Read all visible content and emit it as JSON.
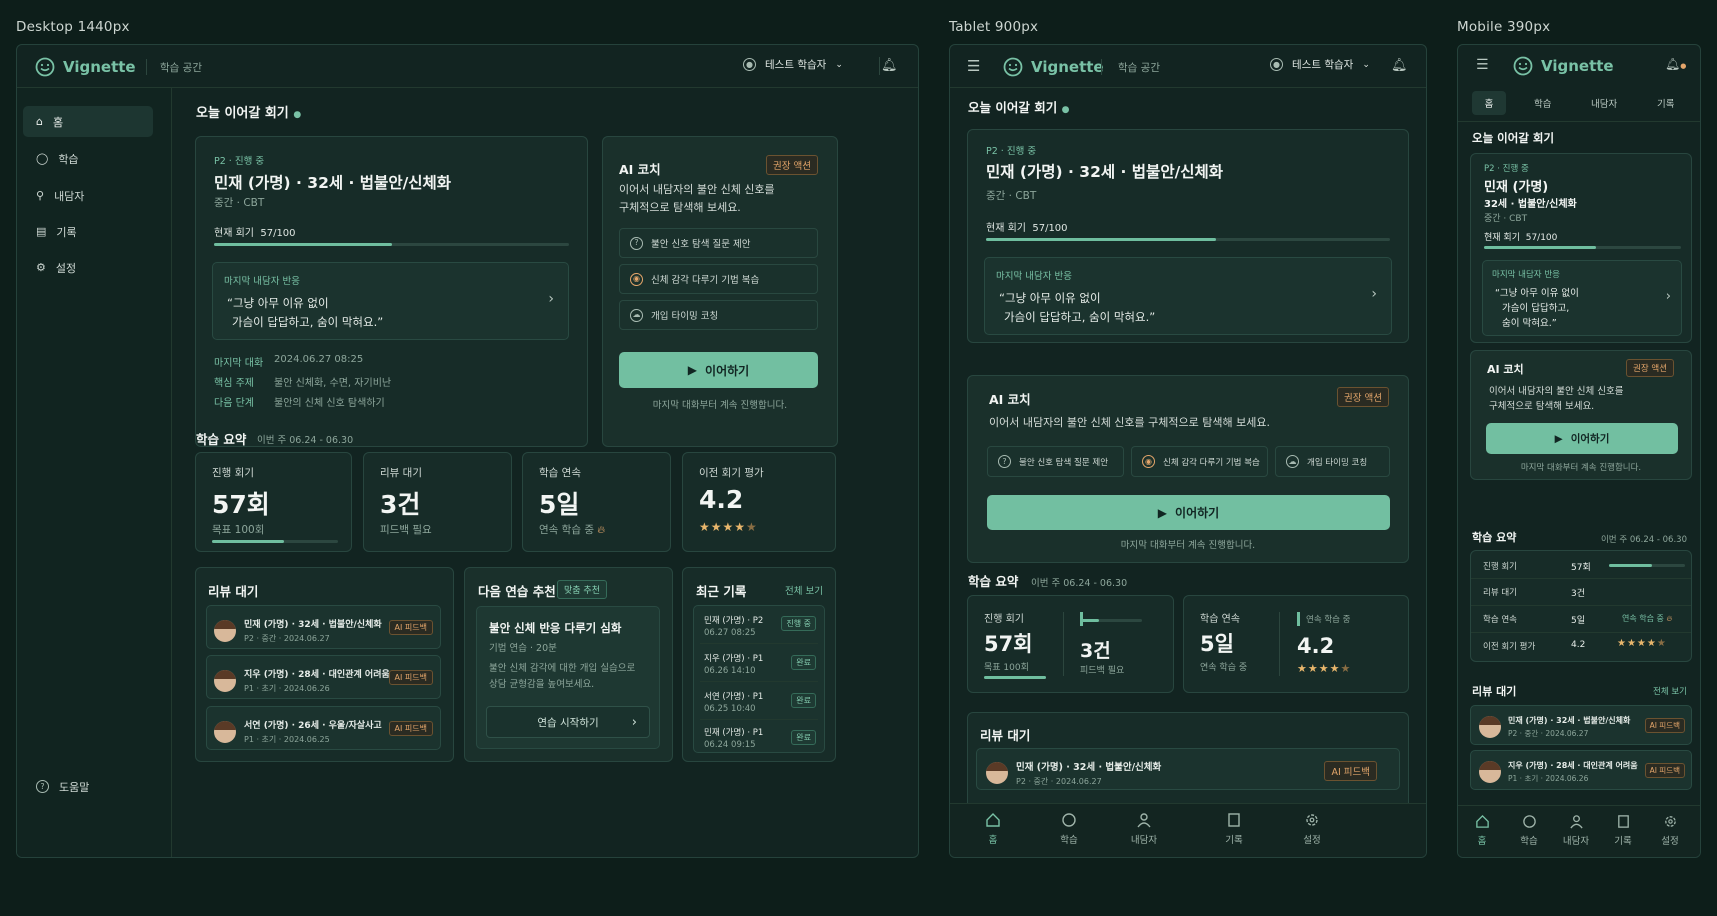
{
  "frames": {
    "desktop": "Desktop  1440px",
    "tablet": "Tablet  900px",
    "mobile": "Mobile  390px"
  },
  "app": {
    "name": "Vignette",
    "workspace": "학습 공간",
    "user": "테스트 학습자"
  },
  "nav": {
    "home": "홈",
    "learn": "학습",
    "clients": "내담자",
    "records": "기록",
    "settings": "설정",
    "help": "도움말"
  },
  "continue": {
    "title": "오늘 이어갈 회기",
    "tag": "P2 · 진행 중",
    "name": "민재 (가명) · 32세 · 법불안/신체화",
    "name_short": "민재 (가명)",
    "name_detail": "32세 · 법불안/신체화",
    "level": "중간 · CBT",
    "session_label": "현재 회기",
    "session_value": "57/100",
    "session_fraction": 0.57,
    "last_response_label": "마지막 내담자 반응",
    "quote1": "“그냥 아무 이유 없이",
    "quote2": "가슴이 답답하고, 숨이 막혀요.”",
    "quote2a": "가슴이 답답하고,",
    "quote2b": "숨이 막혀요.”",
    "last_chat_label": "마지막 대화",
    "last_chat": "2024.06.27  08:25",
    "topic_label": "핵심 주제",
    "topic": "불안 신체화, 수면, 자기비난",
    "next_label": "다음 단계",
    "next": "불안의 신체 신호 탐색하기"
  },
  "coach": {
    "title": "AI 코치",
    "badge": "권장 액션",
    "desc1": "이어서 내담자의 불안 신체 신호를",
    "desc2": "구체적으로 탐색해 보세요.",
    "desc_full": "이어서 내담자의 불안 신체 신호를 구체적으로 탐색해 보세요.",
    "chip1": "불안 신호 탐색 질문 제안",
    "chip2": "신체 감각 다루기 기법 복습",
    "chip3": "개입 타이밍 코칭",
    "cta": "이어하기",
    "note": "마지막 대화부터 계속 진행합니다."
  },
  "summary": {
    "title": "학습 요약",
    "range": "이번 주  06.24 - 06.30",
    "s1_label": "진행 회기",
    "s1_value": "57회",
    "s1_sub": "목표 100회",
    "s1_fraction": 0.57,
    "s2_label": "리뷰 대기",
    "s2_value": "3건",
    "s2_sub": "피드백 필요",
    "s3_label": "학습 연속",
    "s3_value": "5일",
    "s3_sub": "연속 학습 중",
    "s4_label": "이전 회기 평가",
    "s4_value": "4.2",
    "rating": 4.2
  },
  "review": {
    "title": "리뷰 대기",
    "all": "전체 보기",
    "items": [
      {
        "name": "민재 (가명) · 32세 · 법불안/신체화",
        "meta": "P2 · 중간 · 2024.06.27",
        "badge": "AI 피드백"
      },
      {
        "name": "지우 (가명) · 28세 · 대인관계 어려움",
        "meta": "P1 · 초기 · 2024.06.26",
        "badge": "AI 피드백"
      },
      {
        "name": "서연 (가명) · 26세 · 우울/자살사고",
        "meta": "P1 · 초기 · 2024.06.25",
        "badge": "AI 피드백"
      }
    ]
  },
  "practice": {
    "title": "다음 연습 추천",
    "badge": "맞춤 추천",
    "name": "불안 신체 반응 다루기 심화",
    "meta": "기법 연습 · 20분",
    "desc1": "불안 신체 감각에 대한 개입 실습으로",
    "desc2": "상담 균형감을 높여보세요.",
    "cta": "연습 시작하기"
  },
  "records": {
    "title": "최근 기록",
    "all": "전체 보기",
    "items": [
      {
        "name": "민재 (가명) · P2",
        "date": "06.27 08:25",
        "status": "진행 중"
      },
      {
        "name": "지우 (가명) · P1",
        "date": "06.26 14:10",
        "status": "완료"
      },
      {
        "name": "서연 (가명) · P1",
        "date": "06.25 10:40",
        "status": "완료"
      },
      {
        "name": "민재 (가명) · P1",
        "date": "06.24 09:15",
        "status": "완료"
      }
    ]
  },
  "mobile_tabs": {
    "t1": "홈",
    "t2": "학습",
    "t3": "내담자",
    "t4": "기록"
  },
  "colors": {
    "accent": "#72bfa1",
    "warning": "#e3a56a",
    "background": "#0d1e1a"
  }
}
